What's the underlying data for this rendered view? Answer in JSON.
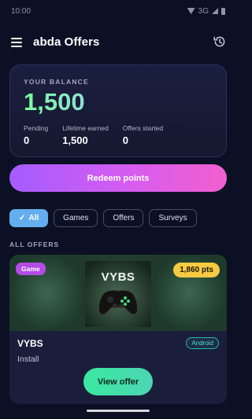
{
  "status_bar": {
    "time": "10:00",
    "network": "3G"
  },
  "app_bar": {
    "title": "abda Offers",
    "menu_icon": "menu-icon",
    "history_icon": "history-icon"
  },
  "balance": {
    "label": "YOUR BALANCE",
    "value": "1,500",
    "stats": [
      {
        "label": "Pending",
        "value": "0"
      },
      {
        "label": "Lifetime earned",
        "value": "1,500"
      },
      {
        "label": "Offers started",
        "value": "0"
      }
    ]
  },
  "redeem_button": {
    "label": "Redeem points"
  },
  "filters": {
    "active": {
      "label": "All",
      "icon": "check-icon"
    },
    "items": [
      {
        "label": "Games"
      },
      {
        "label": "Offers"
      },
      {
        "label": "Surveys"
      }
    ]
  },
  "section_label": "ALL OFFERS",
  "offer": {
    "category": "Game",
    "points": "1,860 pts",
    "art_title": "VYBS",
    "title": "VYBS",
    "platform": "Android",
    "action": "Install",
    "button": "View offer"
  },
  "colors": {
    "background": "#0c1024",
    "accent_purple": "#b34ce4",
    "accent_pink": "#f25fcf",
    "chip_active": "#64aef0",
    "points_badge": "#f6ca41",
    "offer_button": "#3be8a0",
    "platform_badge": "#2bb9b0"
  }
}
